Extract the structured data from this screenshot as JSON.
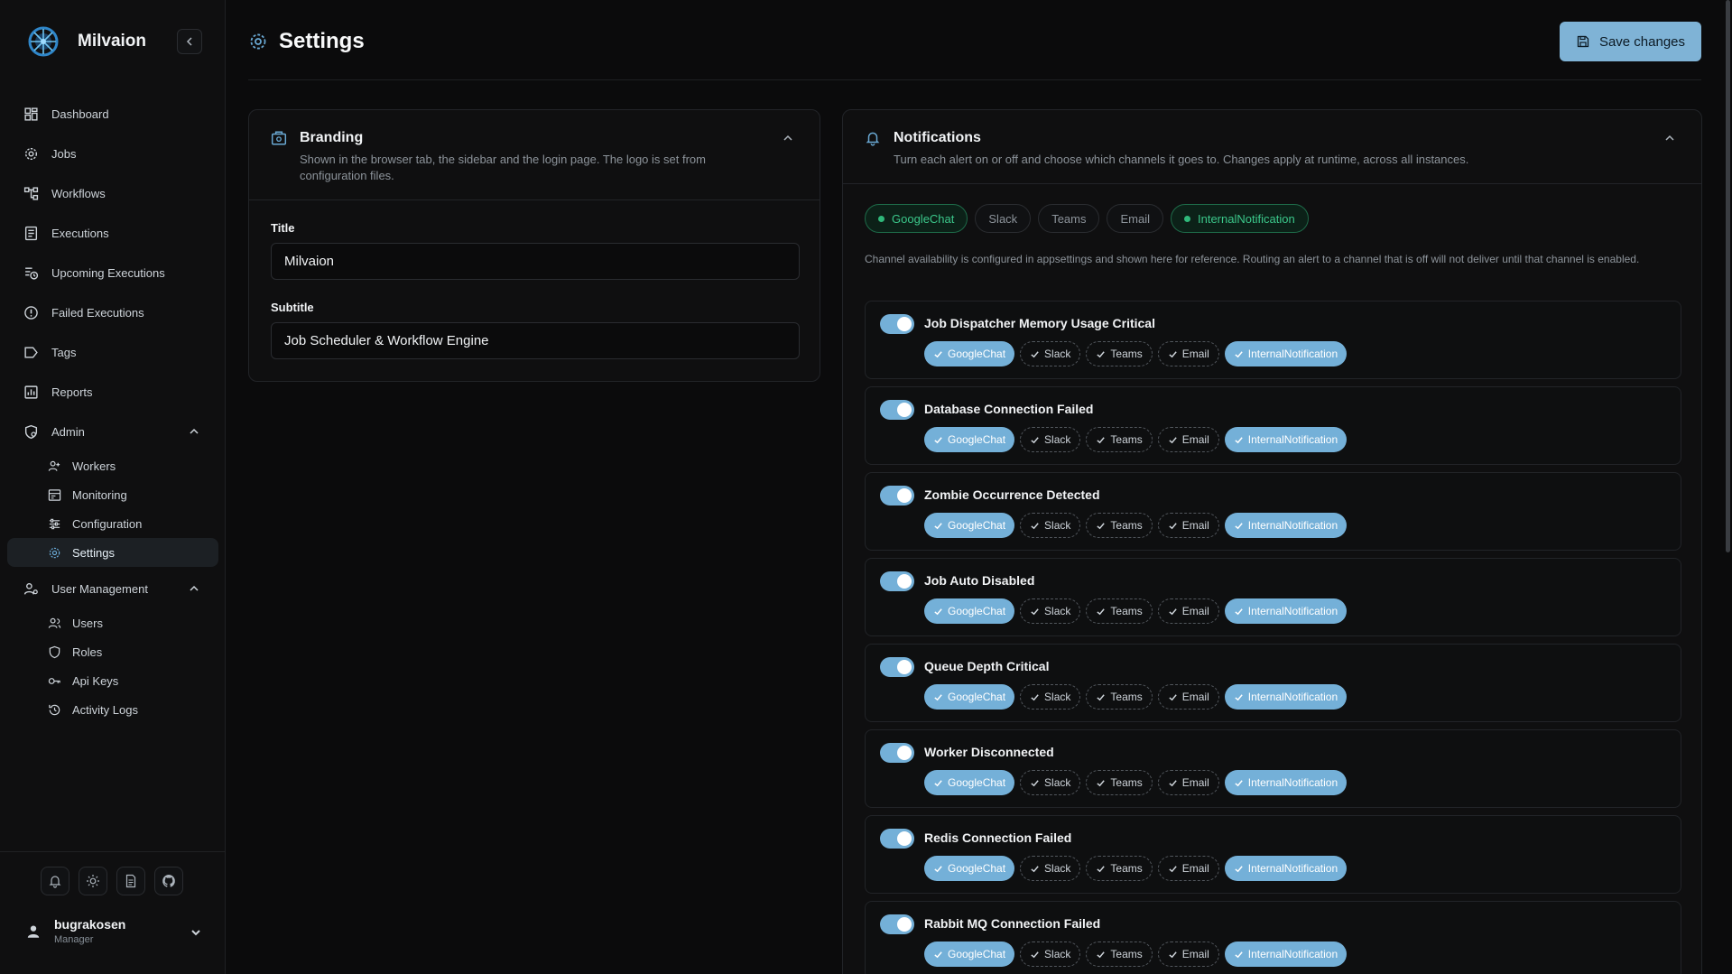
{
  "app": {
    "name": "Milvaion"
  },
  "nav": {
    "items": [
      {
        "label": "Dashboard"
      },
      {
        "label": "Jobs"
      },
      {
        "label": "Workflows"
      },
      {
        "label": "Executions"
      },
      {
        "label": "Upcoming Executions"
      },
      {
        "label": "Failed Executions"
      },
      {
        "label": "Tags"
      },
      {
        "label": "Reports"
      }
    ],
    "admin": {
      "label": "Admin",
      "children": [
        {
          "label": "Workers"
        },
        {
          "label": "Monitoring"
        },
        {
          "label": "Configuration"
        },
        {
          "label": "Settings"
        }
      ]
    },
    "user_management": {
      "label": "User Management",
      "children": [
        {
          "label": "Users"
        },
        {
          "label": "Roles"
        },
        {
          "label": "Api Keys"
        },
        {
          "label": "Activity Logs"
        }
      ]
    }
  },
  "user": {
    "name": "bugrakosen",
    "role": "Manager"
  },
  "header": {
    "title": "Settings",
    "save_label": "Save changes"
  },
  "branding": {
    "title": "Branding",
    "description": "Shown in the browser tab, the sidebar and the login page. The logo is set from configuration files.",
    "title_label": "Title",
    "title_value": "Milvaion",
    "subtitle_label": "Subtitle",
    "subtitle_value": "Job Scheduler & Workflow Engine"
  },
  "notifications": {
    "title": "Notifications",
    "description": "Turn each alert on or off and choose which channels it goes to. Changes apply at runtime, across all instances.",
    "channels": [
      {
        "label": "GoogleChat",
        "enabled": true
      },
      {
        "label": "Slack",
        "enabled": false
      },
      {
        "label": "Teams",
        "enabled": false
      },
      {
        "label": "Email",
        "enabled": false
      },
      {
        "label": "InternalNotification",
        "enabled": true
      }
    ],
    "availability_note": "Channel availability is configured in appsettings and shown here for reference. Routing an alert to a channel that is off will not deliver until that channel is enabled.",
    "alerts": [
      {
        "name": "Job Dispatcher Memory Usage Critical",
        "enabled": true
      },
      {
        "name": "Database Connection Failed",
        "enabled": true
      },
      {
        "name": "Zombie Occurrence Detected",
        "enabled": true
      },
      {
        "name": "Job Auto Disabled",
        "enabled": true
      },
      {
        "name": "Queue Depth Critical",
        "enabled": true
      },
      {
        "name": "Worker Disconnected",
        "enabled": true
      },
      {
        "name": "Redis Connection Failed",
        "enabled": true
      },
      {
        "name": "Rabbit MQ Connection Failed",
        "enabled": true
      }
    ],
    "alert_channels": [
      {
        "label": "GoogleChat",
        "selected": true
      },
      {
        "label": "Slack",
        "selected": false
      },
      {
        "label": "Teams",
        "selected": false
      },
      {
        "label": "Email",
        "selected": false
      },
      {
        "label": "InternalNotification",
        "selected": true
      }
    ]
  },
  "colors": {
    "accent": "#74b0d8",
    "success": "#3bc78a",
    "background": "#0b0b0c"
  }
}
